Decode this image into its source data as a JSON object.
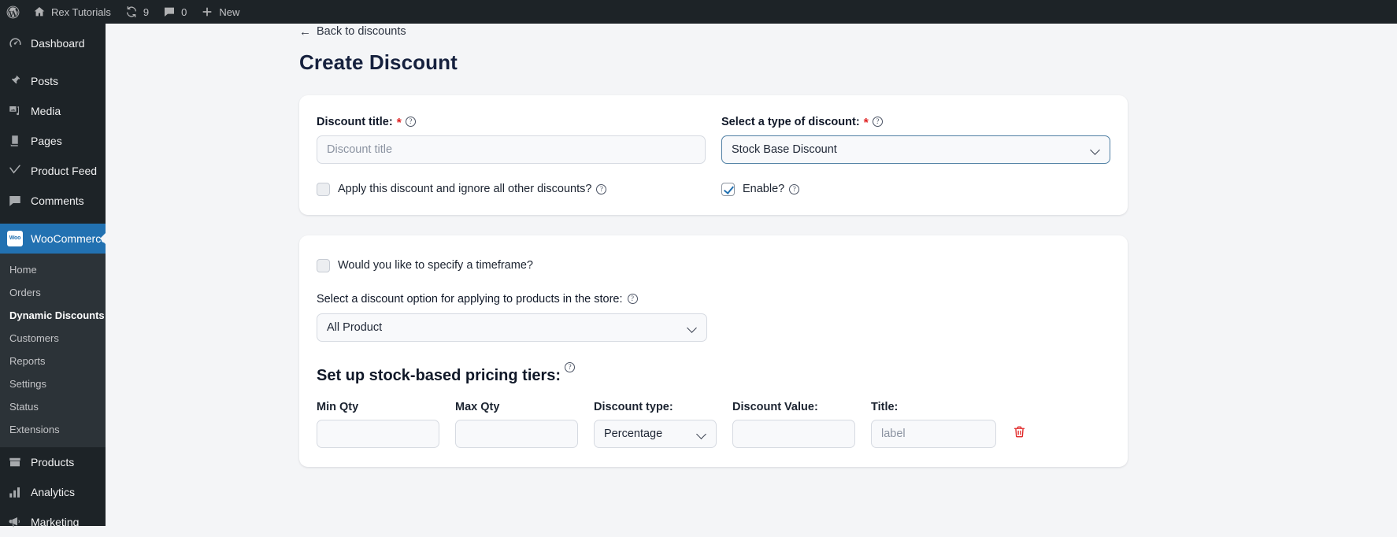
{
  "adminbar": {
    "wp_logo_icon": "wordpress-logo-icon",
    "site_icon": "home-icon",
    "site_name": "Rex Tutorials",
    "updates_icon": "updates-icon",
    "updates_count": "9",
    "comments_icon": "comment-bubble-icon",
    "comments_count": "0",
    "new_icon": "plus-icon",
    "new_label": "New"
  },
  "sidebar": {
    "items": [
      {
        "label": "Dashboard",
        "icon": "dashboard-icon",
        "current": false
      },
      {
        "label": "Posts",
        "icon": "pin-icon",
        "current": false
      },
      {
        "label": "Media",
        "icon": "media-icon",
        "current": false
      },
      {
        "label": "Pages",
        "icon": "pages-icon",
        "current": false
      },
      {
        "label": "Product Feed",
        "icon": "feed-icon",
        "current": false
      },
      {
        "label": "Comments",
        "icon": "comment-bubble-icon",
        "current": false
      },
      {
        "label": "WooCommerce",
        "icon": "woocommerce-icon",
        "current": true
      },
      {
        "label": "Products",
        "icon": "products-icon",
        "current": false
      },
      {
        "label": "Analytics",
        "icon": "analytics-icon",
        "current": false
      },
      {
        "label": "Marketing",
        "icon": "marketing-icon",
        "current": false
      }
    ],
    "woo_badge_text": "Woo",
    "submenu": [
      {
        "label": "Home",
        "current": false
      },
      {
        "label": "Orders",
        "current": false
      },
      {
        "label": "Dynamic Discounts",
        "current": true
      },
      {
        "label": "Customers",
        "current": false
      },
      {
        "label": "Reports",
        "current": false
      },
      {
        "label": "Settings",
        "current": false
      },
      {
        "label": "Status",
        "current": false
      },
      {
        "label": "Extensions",
        "current": false
      }
    ]
  },
  "main": {
    "back_link": "Back to discounts",
    "back_arrow": "←",
    "page_title": "Create Discount",
    "card1": {
      "discount_title_label": "Discount title:",
      "discount_title_required": "*",
      "discount_title_placeholder": "Discount title",
      "discount_title_value": "",
      "type_label": "Select a type of discount:",
      "type_required": "*",
      "type_value": "Stock Base Discount",
      "ignore_others_label": "Apply this discount and ignore all other discounts?",
      "ignore_others_checked": false,
      "enable_label": "Enable?",
      "enable_checked": true
    },
    "card2": {
      "timeframe_label": "Would you like to specify a timeframe?",
      "timeframe_checked": false,
      "apply_option_label": "Select a discount option for applying to products in the store:",
      "apply_option_value": "All Product",
      "tiers_heading": "Set up stock-based pricing tiers:",
      "tier_headers": {
        "min_qty": "Min Qty",
        "max_qty": "Max Qty",
        "discount_type": "Discount type:",
        "discount_value": "Discount Value:",
        "title": "Title:"
      },
      "tier_rows": [
        {
          "min_qty": "",
          "max_qty": "",
          "discount_type": "Percentage",
          "discount_value": "",
          "title": "",
          "title_placeholder": "label",
          "delete_icon": "trash-icon"
        }
      ]
    }
  },
  "colors": {
    "admin_dark": "#1d2327",
    "admin_submenu": "#2c3338",
    "accent_blue": "#2271b1",
    "page_bg": "#f4f5f7",
    "title_navy": "#16213e",
    "required_red": "#e02424",
    "focus_border": "#4f7fa3"
  }
}
